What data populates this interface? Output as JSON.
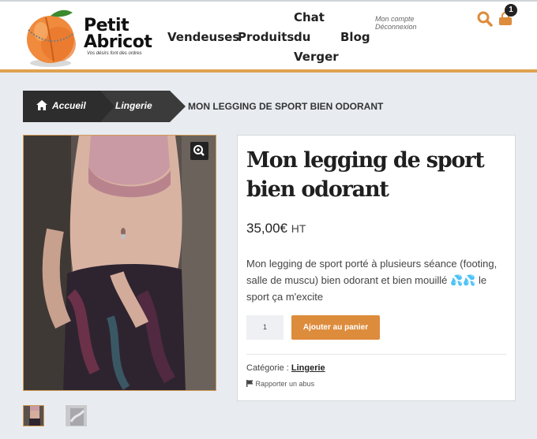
{
  "header": {
    "logo": {
      "word1": "Petit",
      "word2": "Abricot",
      "tagline": "Vos désirs font des ordres"
    },
    "nav": [
      {
        "label": "Vendeuses"
      },
      {
        "label": "Produits"
      },
      {
        "label": "Chat du Verger"
      },
      {
        "label": "Blog"
      }
    ],
    "account": {
      "line1": "Mon compte",
      "line2": "Déconnexion"
    },
    "cart": {
      "count": "1"
    },
    "accent_color": "#dfa250"
  },
  "breadcrumb": {
    "home": "Accueil",
    "category": "Lingerie",
    "current": "MON LEGGING DE SPORT BIEN ODORANT"
  },
  "product": {
    "title": "Mon legging de sport bien odorant",
    "price": "35,00€",
    "tax_label": "HT",
    "description": "Mon legging de sport porté à plusieurs séance (footing, salle de muscu) bien odorant et bien mouillé 💦💦 le sport ça m'excite",
    "quantity": "1",
    "add_to_cart": "Ajouter au panier",
    "category_label": "Catégorie :",
    "category_value": "Lingerie",
    "report": "Rapporter un abus",
    "button_color": "#dd8c3c"
  },
  "icons": [
    "peach-logo-icon",
    "search-icon",
    "cart-icon",
    "home-icon",
    "zoom-icon",
    "flag-icon"
  ]
}
